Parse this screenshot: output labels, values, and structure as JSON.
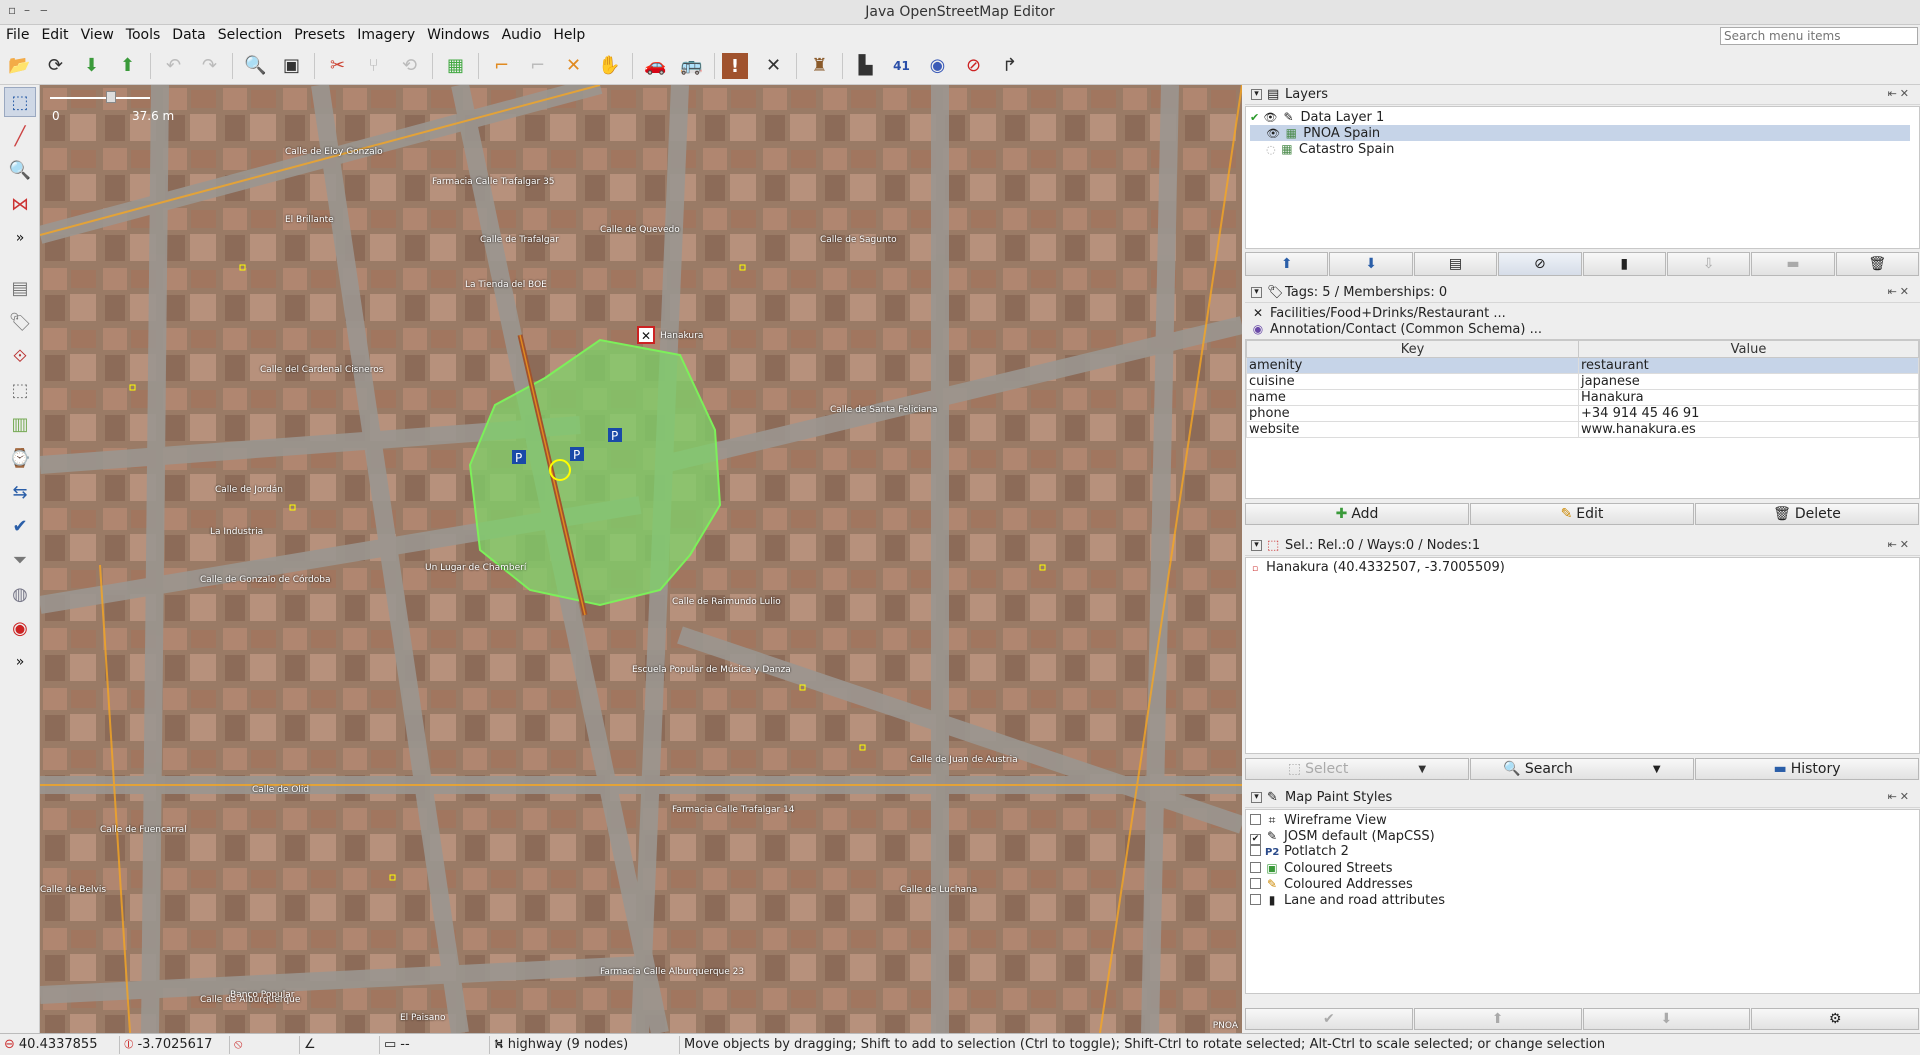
{
  "window": {
    "title": "Java OpenStreetMap Editor",
    "min": "–",
    "max": "▢",
    "close": "✕"
  },
  "menu": {
    "items": [
      "File",
      "Edit",
      "View",
      "Tools",
      "Data",
      "Selection",
      "Presets",
      "Imagery",
      "Windows",
      "Audio",
      "Help"
    ],
    "search_placeholder": "Search menu items"
  },
  "toolbar_icons": [
    "open-icon",
    "reload-icon",
    "download-icon",
    "upload-icon",
    "undo-icon",
    "redo-icon",
    "zoom-preferences-icon",
    "ocr-icon",
    "split-way-icon",
    "combine-icon",
    "refresh-icon",
    "layer-icon",
    "ruler-icon",
    "cut-icon",
    "tool-icon",
    "hand-icon",
    "car-icon",
    "bus-icon",
    "warning-icon",
    "restaurant-icon",
    "castle-icon",
    "factory-icon",
    "address-41-icon",
    "globe-icon",
    "no-entry-icon",
    "turn-icon"
  ],
  "left_tools": [
    "select-icon",
    "draw-icon",
    "zoom-icon",
    "improve-way-icon",
    "more-icon",
    "layers-toggle-icon",
    "tags-toggle-icon",
    "relations-icon",
    "selection-list-icon",
    "commands-icon",
    "history-icon",
    "map-paint-icon",
    "validation-icon",
    "filter-icon",
    "styles-icon",
    "notes-icon",
    "more-icon"
  ],
  "map": {
    "scale_left": "0",
    "scale_right": "37.6 m",
    "streets": [
      "Calle de Eloy Gonzalo",
      "Calle de Trafalgar",
      "Calle de Quevedo",
      "Calle de Sagunto",
      "Calle de Santa Feliciana",
      "Calle de Jordán",
      "Calle del Cardenal Cisneros",
      "Calle de Gonzalo de Córdoba",
      "Calle de Raimundo Lulio",
      "Calle de Olid",
      "Calle de Belvis",
      "Calle de Fuencarral",
      "Calle de Alburquerque",
      "Calle de Luchana",
      "Calle de Juan de Austria"
    ],
    "pois": [
      "Hanakura",
      "Farmacia Calle Trafalgar 35",
      "La Tienda del BOE",
      "El Brillante",
      "Un Lugar de Chamberí",
      "La Industria",
      "Farmacia Calle Trafalgar 14",
      "Escuela Popular de Música y Danza",
      "Farmacia Calle Alburquerque 23",
      "Banco Popular",
      "El Paisano"
    ],
    "attribution": "PNOA"
  },
  "layers": {
    "title": "Layers",
    "items": [
      {
        "name": "Data Layer 1",
        "active": true
      },
      {
        "name": "PNOA Spain",
        "selected": true
      },
      {
        "name": "Catastro Spain"
      }
    ]
  },
  "tags": {
    "title": "Tags: 5 / Memberships: 0",
    "presets": [
      "Facilities/Food+Drinks/Restaurant ...",
      "Annotation/Contact (Common Schema) ..."
    ],
    "col_key": "Key",
    "col_value": "Value",
    "rows": [
      {
        "key": "amenity",
        "value": "restaurant"
      },
      {
        "key": "cuisine",
        "value": "japanese"
      },
      {
        "key": "name",
        "value": "Hanakura"
      },
      {
        "key": "phone",
        "value": "+34 914 45 46 91"
      },
      {
        "key": "website",
        "value": "www.hanakura.es"
      }
    ],
    "add": "Add",
    "edit": "Edit",
    "delete": "Delete"
  },
  "selection": {
    "title": "Sel.: Rel.:0 / Ways:0 / Nodes:1",
    "items": [
      "Hanakura (40.4332507, -3.7005509)"
    ],
    "select": "Select",
    "search": "Search",
    "history": "History"
  },
  "styles": {
    "title": "Map Paint Styles",
    "items": [
      {
        "name": "Wireframe View",
        "checked": false
      },
      {
        "name": "JOSM default (MapCSS)",
        "checked": true
      },
      {
        "name": "Potlatch 2",
        "checked": false
      },
      {
        "name": "Coloured Streets",
        "checked": false
      },
      {
        "name": "Coloured Addresses",
        "checked": false
      },
      {
        "name": "Lane and road attributes",
        "checked": false
      }
    ]
  },
  "status": {
    "lat": "40.4337855",
    "lon": "-3.7025617",
    "heading": "",
    "angle": "",
    "length": "--",
    "way_info": "highway (9 nodes)",
    "help": "Move objects by dragging; Shift to add to selection (Ctrl to toggle); Shift-Ctrl to rotate selected; Alt-Ctrl to scale selected; or change selection"
  },
  "colors": {
    "accent": "#c6d4e8",
    "park": "#7fd36a",
    "selection": "#ffff00"
  }
}
